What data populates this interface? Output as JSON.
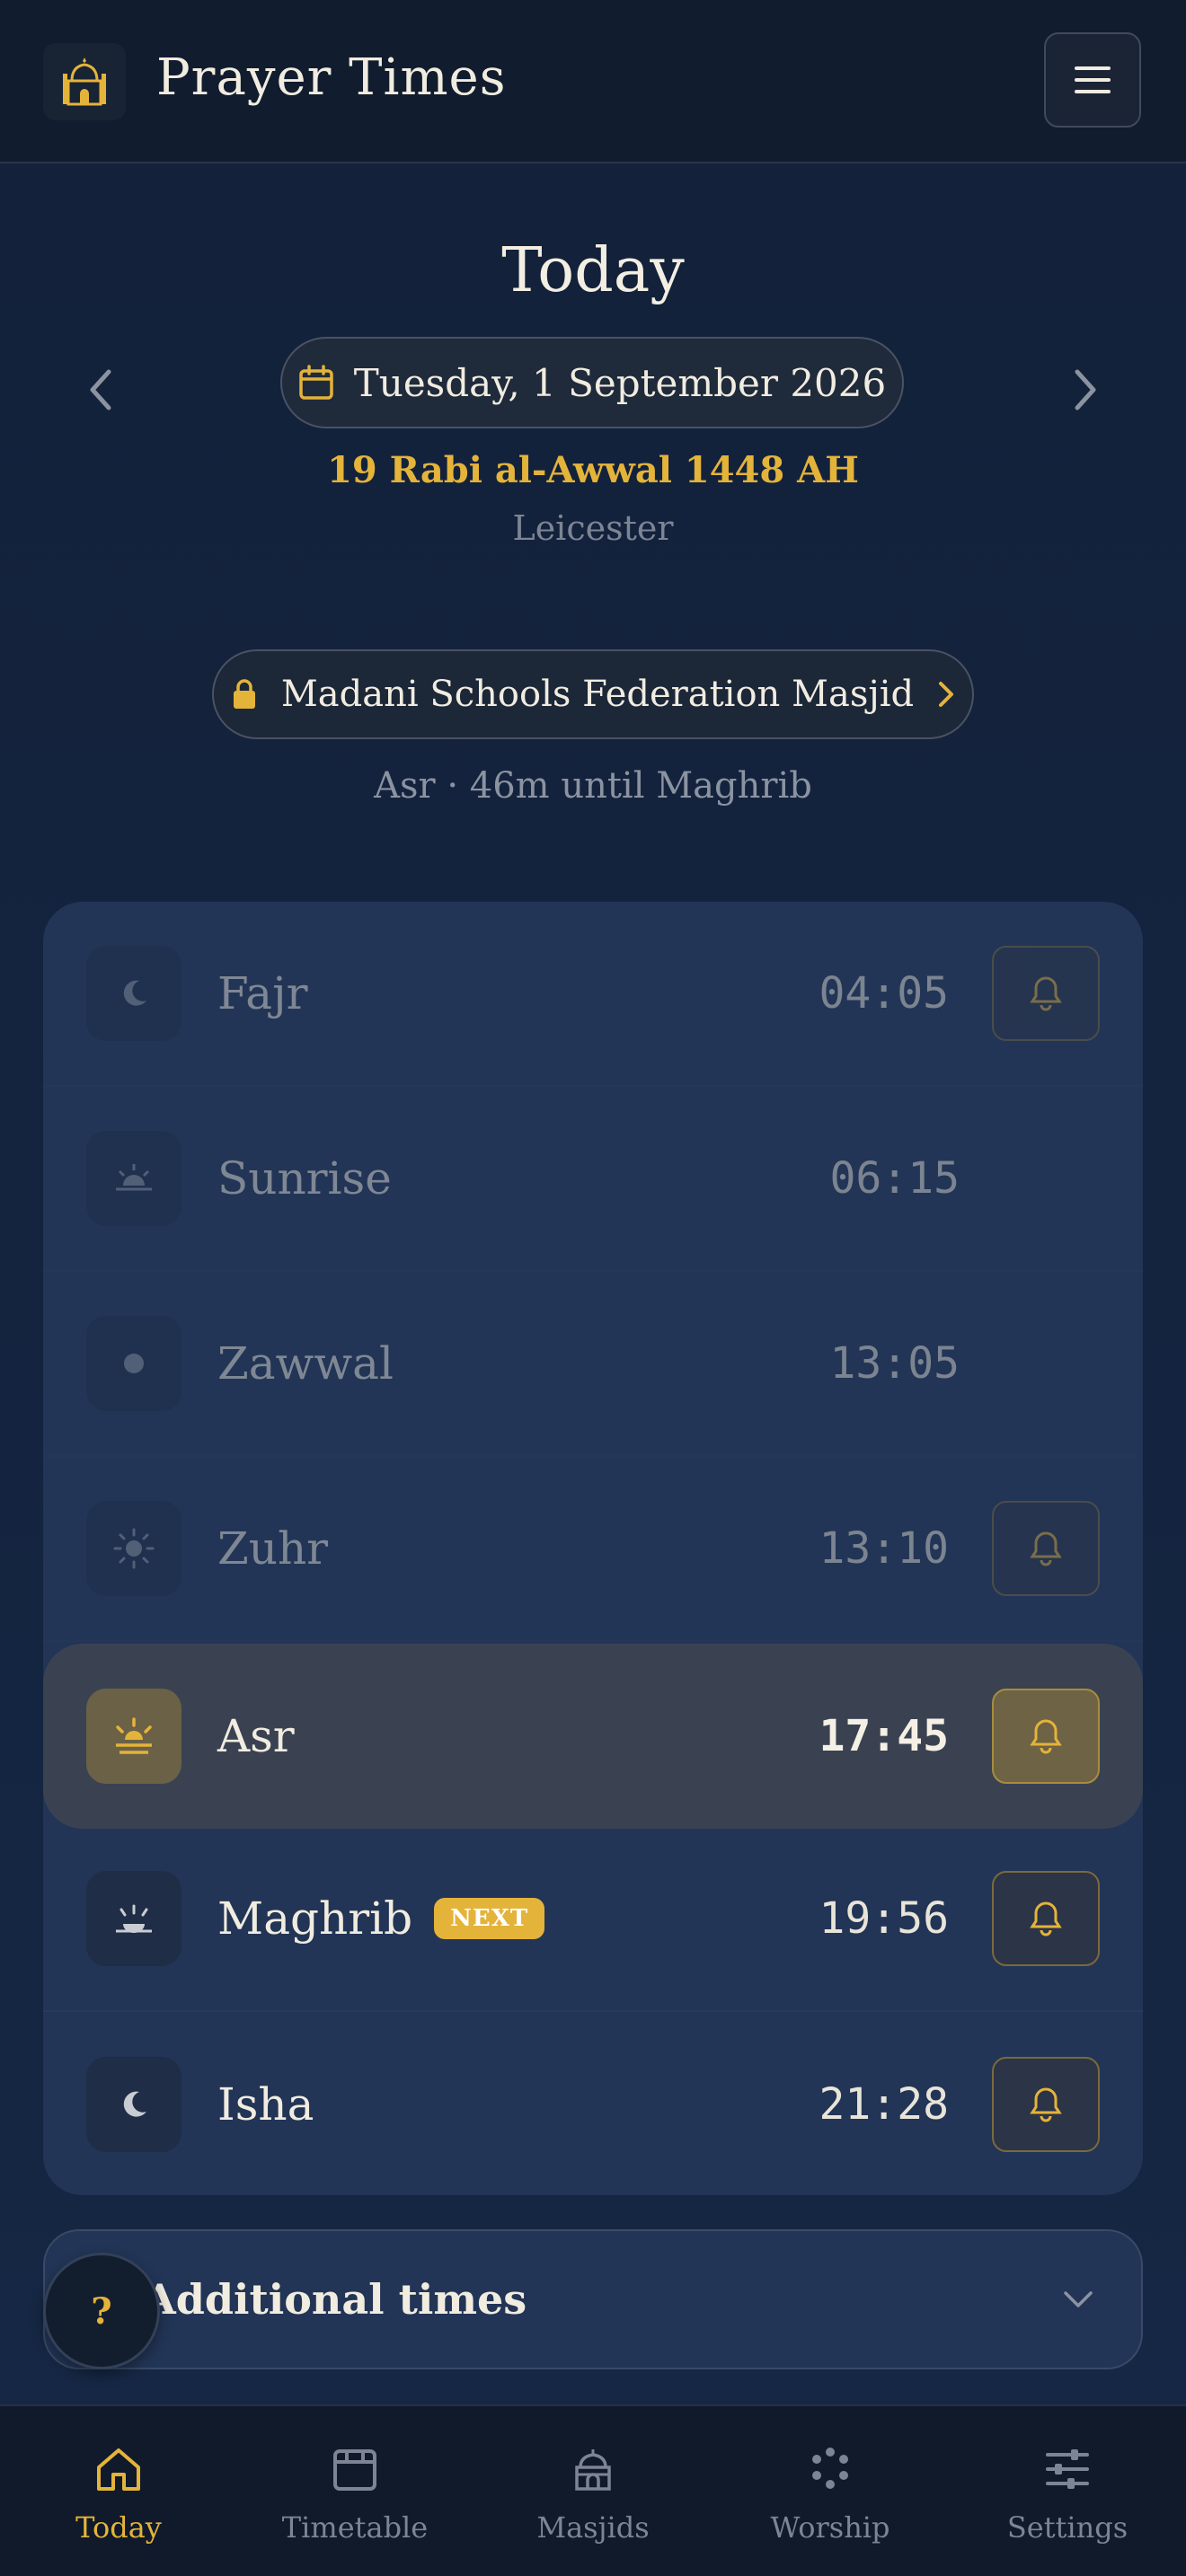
{
  "header": {
    "title": "Prayer Times",
    "logo_icon": "mosque-icon",
    "menu_icon": "hamburger-menu-icon"
  },
  "date_section": {
    "title": "Today",
    "gregorian": "Tuesday, 1 September 2026",
    "hijri": "19 Rabi al-Awwal 1448 AH",
    "city": "Leicester"
  },
  "masjid": {
    "name": "Madani Schools Federation Masjid"
  },
  "countdown": "Asr · 46m until Maghrib",
  "prayers": [
    {
      "name": "Fajr",
      "time": "04:05",
      "icon": "crescent-moon-icon",
      "state": "past",
      "bell": true
    },
    {
      "name": "Sunrise",
      "time": "06:15",
      "icon": "sunrise-icon",
      "state": "past",
      "bell": false
    },
    {
      "name": "Zawwal",
      "time": "13:05",
      "icon": "dot-icon",
      "state": "past",
      "bell": false
    },
    {
      "name": "Zuhr",
      "time": "13:10",
      "icon": "sun-icon",
      "state": "past",
      "bell": true
    },
    {
      "name": "Asr",
      "time": "17:45",
      "icon": "afternoon-sun-icon",
      "state": "current",
      "bell": true
    },
    {
      "name": "Maghrib",
      "time": "19:56",
      "icon": "sunset-icon",
      "state": "next",
      "bell": true,
      "badge": "NEXT"
    },
    {
      "name": "Isha",
      "time": "21:28",
      "icon": "crescent-moon-icon",
      "state": "upcoming",
      "bell": true
    }
  ],
  "additional": {
    "label": "Additional times"
  },
  "help": {
    "label": "?"
  },
  "nav": [
    {
      "label": "Today",
      "icon": "home-icon",
      "active": true
    },
    {
      "label": "Timetable",
      "icon": "calendar-icon",
      "active": false
    },
    {
      "label": "Masjids",
      "icon": "mosque-icon",
      "active": false
    },
    {
      "label": "Worship",
      "icon": "beads-icon",
      "active": false
    },
    {
      "label": "Settings",
      "icon": "sliders-icon",
      "active": false
    }
  ],
  "colors": {
    "accent": "#e4b33a",
    "background": "#111c2e",
    "card": "#223556",
    "current_row": "#3a4252"
  }
}
